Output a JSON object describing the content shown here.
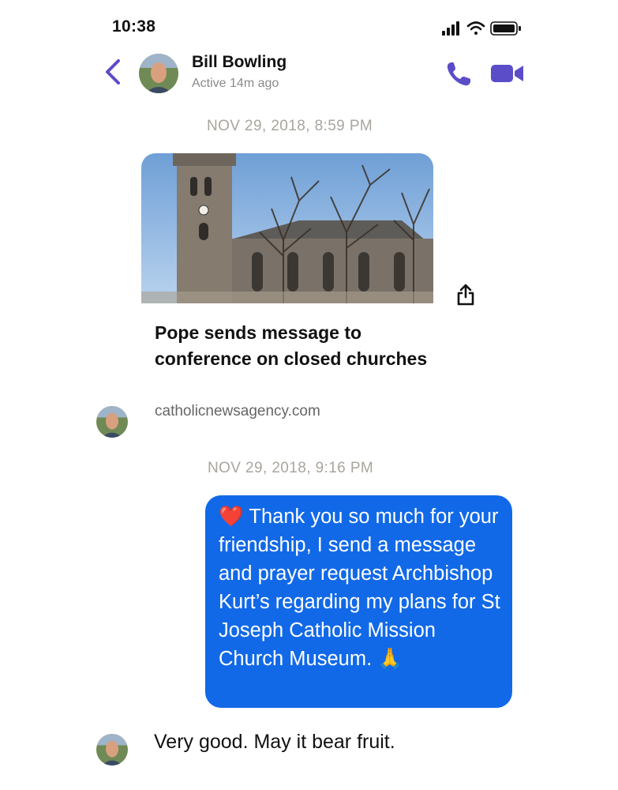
{
  "status_bar": {
    "time": "10:38"
  },
  "header": {
    "contact_name": "Bill Bowling",
    "active_status": "Active 14m ago",
    "accent_color": "#5b4dc7"
  },
  "messages": [
    {
      "type": "timestamp",
      "text": "NOV 29, 2018, 8:59 PM"
    },
    {
      "type": "link",
      "sender": "Bill Bowling",
      "title": "Pope sends message to conference on closed churches",
      "domain": "catholicnewsagency.com"
    },
    {
      "type": "timestamp",
      "text": "NOV 29, 2018, 9:16 PM"
    },
    {
      "type": "outgoing",
      "emoji_start": "❤️",
      "text": "Thank you so much for your friendship, I send a message and prayer request Archbishop Kurt’s regarding my plans for St Joseph Catholic Mission Church Museum.",
      "emoji_end": "🙏",
      "bubble_color": "#1169e8"
    },
    {
      "type": "incoming",
      "sender": "Bill Bowling",
      "text": "Very good.  May it bear fruit."
    }
  ]
}
